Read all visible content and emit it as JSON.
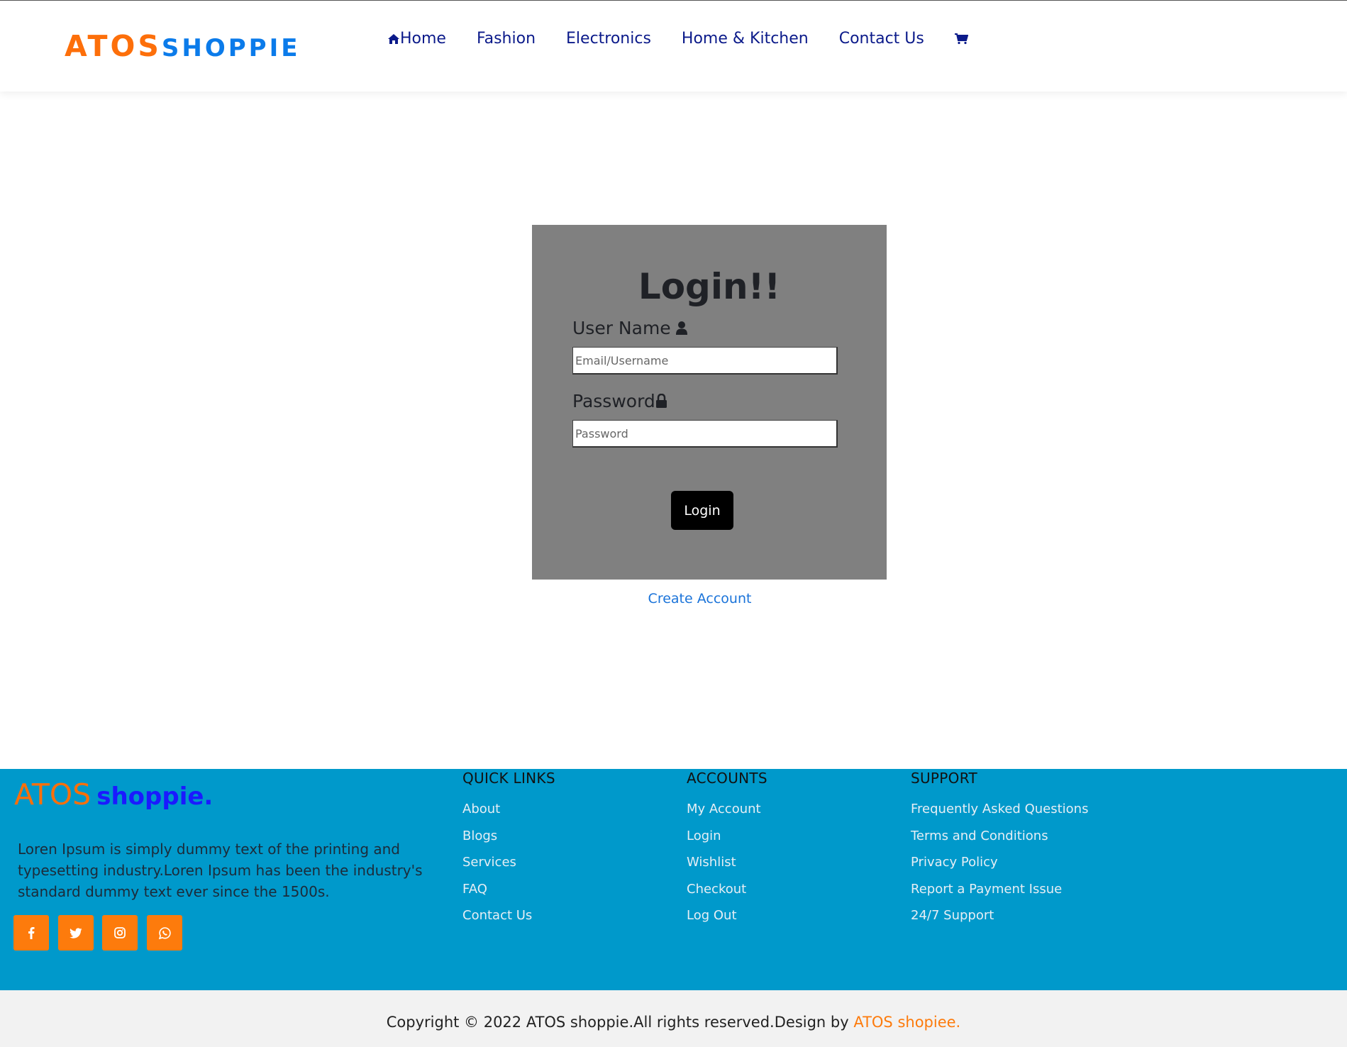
{
  "header": {
    "logo_part1": "ATOS",
    "logo_part2": "SHOPPIE",
    "nav": [
      "Home",
      "Fashion",
      "Electronics",
      "Home & Kitchen",
      "Contact Us"
    ]
  },
  "login": {
    "title": "Login!!",
    "username_label": "User Name",
    "username_placeholder": "Email/Username",
    "password_label": "Password",
    "password_placeholder": "Password",
    "button": "Login",
    "create_account": "Create Account"
  },
  "footer": {
    "logo_part1": "ATOS",
    "logo_part2": "shoppie.",
    "description": "Loren Ipsum is simply dummy text of the printing and typesetting industry.Loren Ipsum has been the industry's standard dummy text ever since the 1500s.",
    "social_icons": [
      "facebook-icon",
      "twitter-icon",
      "instagram-icon",
      "whatsapp-icon"
    ],
    "columns": [
      {
        "title": "QUICK LINKS",
        "links": [
          "About",
          "Blogs",
          "Services",
          "FAQ",
          "Contact Us"
        ]
      },
      {
        "title": "ACCOUNTS",
        "links": [
          "My Account",
          "Login",
          "Wishlist",
          "Checkout",
          "Log Out"
        ]
      },
      {
        "title": "SUPPORT",
        "links": [
          "Frequently Asked Questions",
          "Terms and Conditions",
          "Privacy Policy",
          "Report a Payment Issue",
          "24/7 Support"
        ]
      }
    ],
    "copyright_text": "Copyright © 2022 ATOS shoppie.All rights reserved.Design by ",
    "copyright_brand": "ATOS shopiee."
  },
  "colors": {
    "accent_orange": "#fd6f0a",
    "accent_blue": "#0b7bea",
    "nav_text": "#0b1a8a",
    "footer_bg": "#0099cb",
    "card_bg": "#808080"
  }
}
